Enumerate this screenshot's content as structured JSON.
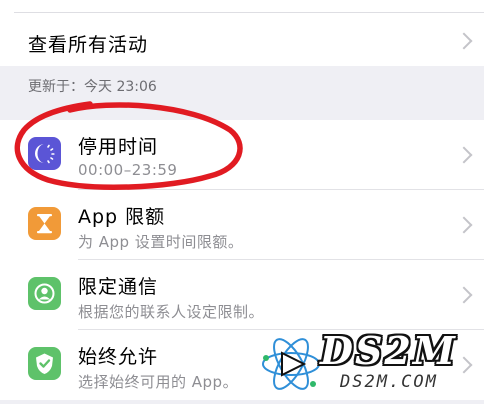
{
  "view_all": {
    "label": "查看所有活动"
  },
  "section": {
    "updated_text": "更新于：今天 23:06"
  },
  "rows": [
    {
      "title": "停用时间",
      "subtitle": "00:00–23:59",
      "icon": "downtime-icon",
      "color": "#5b55d6"
    },
    {
      "title": "App 限额",
      "subtitle": "为 App 设置时间限额。",
      "icon": "hourglass-icon",
      "color": "#f19a38"
    },
    {
      "title": "限定通信",
      "subtitle": "根据您的联系人设定限制。",
      "icon": "person-circle-icon",
      "color": "#5ec26a"
    },
    {
      "title": "始终允许",
      "subtitle": "选择始终可用的 App。",
      "icon": "checkmark-shield-icon",
      "color": "#5ec26a"
    }
  ],
  "watermark": {
    "main": "DS2M",
    "sub": "DS2M.COM"
  },
  "annotation": {
    "color": "#e11b22"
  }
}
